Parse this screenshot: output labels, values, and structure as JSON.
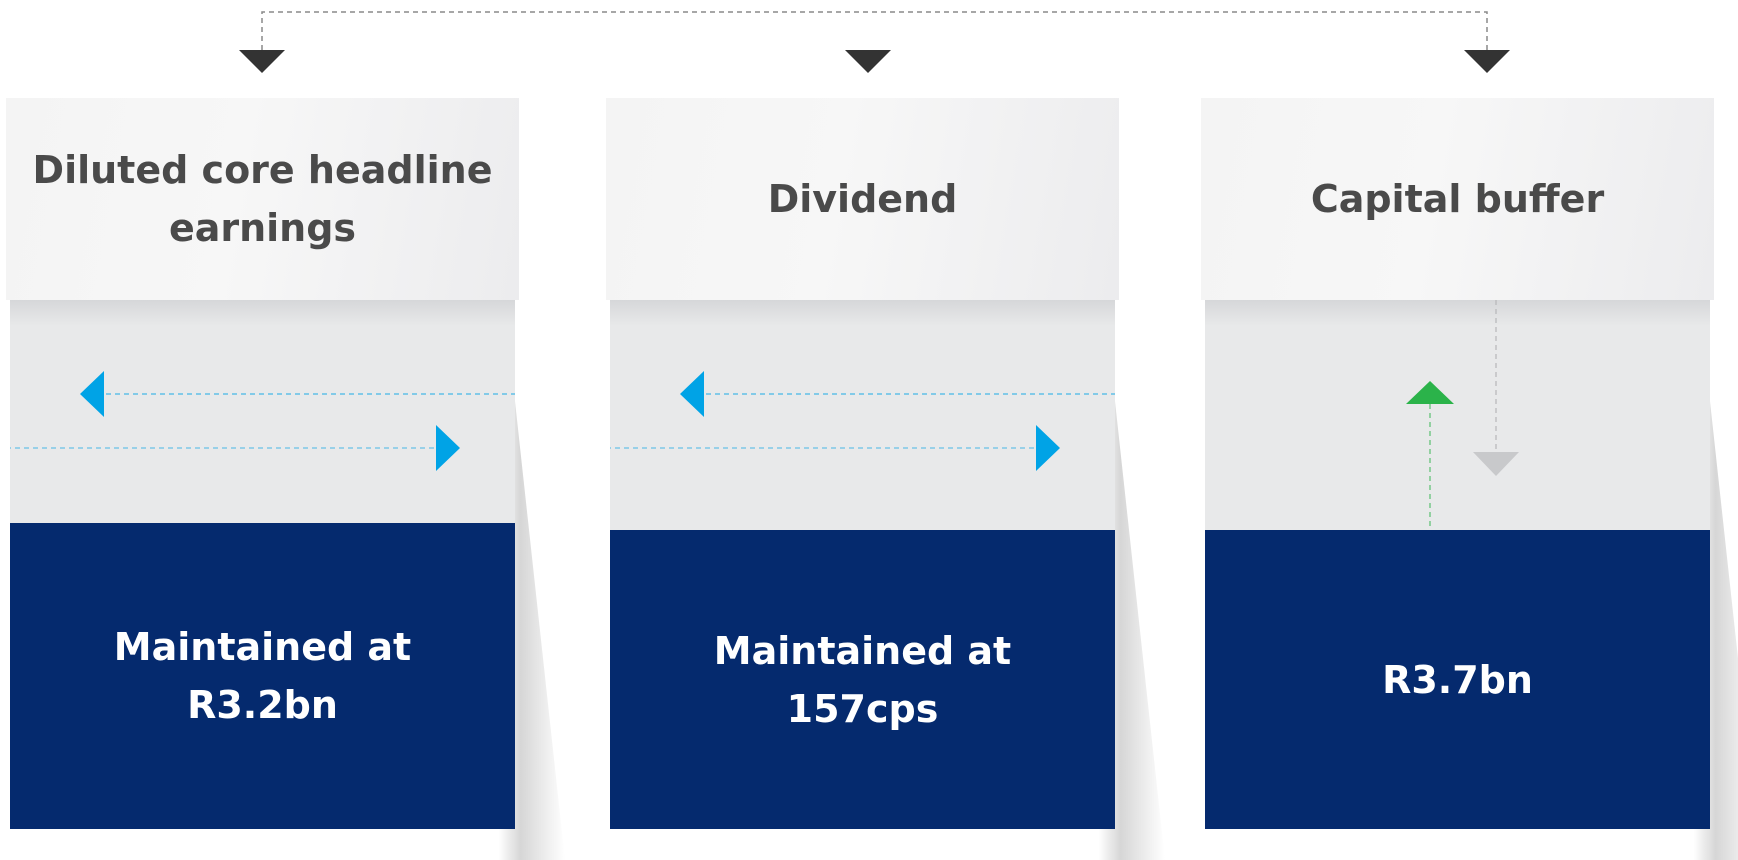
{
  "colors": {
    "header_bg": "#f4f4f4",
    "band_bg": "#e8e9ea",
    "value_bg": "#052a6e",
    "title_text": "#4a4a4a",
    "value_text": "#ffffff",
    "arrow_blue": "#00a3e6",
    "arrow_green": "#2bb34a",
    "arrow_grey": "#c8c9cb",
    "pointer_dark": "#333333"
  },
  "cards": [
    {
      "title": "Diluted core headline\nearnings",
      "value": "Maintained at\nR3.2bn",
      "indicator": "sideways",
      "indicator_icons": [
        "left-arrow-icon",
        "right-arrow-icon"
      ]
    },
    {
      "title": "Dividend",
      "value": "Maintained at\n157cps",
      "indicator": "sideways",
      "indicator_icons": [
        "left-arrow-icon",
        "right-arrow-icon"
      ]
    },
    {
      "title": "Capital buffer",
      "value": "R3.7bn",
      "indicator": "up",
      "indicator_icons": [
        "up-arrow-icon",
        "down-arrow-icon"
      ]
    }
  ]
}
